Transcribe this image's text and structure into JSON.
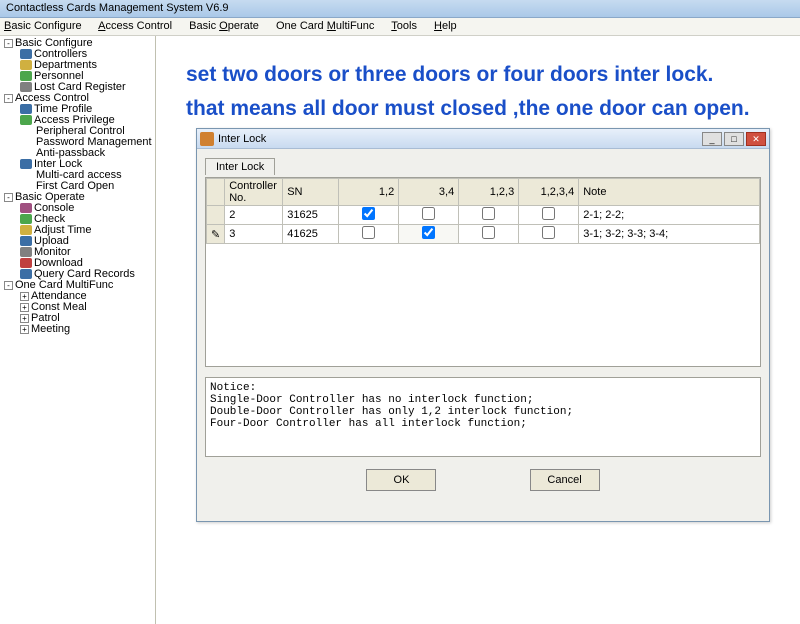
{
  "app": {
    "title": "Contactless Cards Management System  V6.9"
  },
  "menu": {
    "basic_configure": "Basic Configure",
    "access_control": "Access Control",
    "basic_operate": "Basic Operate",
    "one_card": "One Card MultiFunc",
    "tools": "Tools",
    "help": "Help"
  },
  "tree": {
    "basic_configure": "Basic Configure",
    "controllers": "Controllers",
    "departments": "Departments",
    "personnel": "Personnel",
    "lost_card": "Lost Card Register",
    "access_control": "Access Control",
    "time_profile": "Time Profile",
    "access_privilege": "Access Privilege",
    "peripheral": "Peripheral Control",
    "password_mgmt": "Password Management",
    "anti_passback": "Anti-passback",
    "inter_lock": "Inter Lock",
    "multi_card": "Multi-card access",
    "first_card": "First Card Open",
    "basic_operate": "Basic Operate",
    "console": "Console",
    "check": "Check",
    "adjust_time": "Adjust Time",
    "upload": "Upload",
    "monitor": "Monitor",
    "download": "Download",
    "query_records": "Query Card Records",
    "one_card_multi": "One Card MultiFunc",
    "attendance": "Attendance",
    "const_meal": "Const Meal",
    "patrol": "Patrol",
    "meeting": "Meeting"
  },
  "annotation": {
    "line1": "set two doors or three doors or four doors inter lock.",
    "line2": "that means all door must closed ,the one door can open."
  },
  "dialog": {
    "title": "Inter Lock",
    "tab": "Inter Lock",
    "columns": {
      "controller_no": "Controller No.",
      "sn": "SN",
      "c12": "1,2",
      "c34": "3,4",
      "c123": "1,2,3",
      "c1234": "1,2,3,4",
      "note": "Note"
    },
    "rows": [
      {
        "no": "2",
        "sn": "31625",
        "c12": true,
        "c34": false,
        "c123": false,
        "c1234": false,
        "note": "2-1;  2-2;"
      },
      {
        "no": "3",
        "sn": "41625",
        "c12": false,
        "c34": true,
        "c123": false,
        "c1234": false,
        "note": "3-1;  3-2;  3-3;  3-4;"
      }
    ],
    "notice": {
      "heading": "Notice:",
      "l1": "Single-Door Controller has no interlock function;",
      "l2": "Double-Door Controller has only 1,2 interlock function;",
      "l3": "Four-Door Controller has all interlock function;"
    },
    "buttons": {
      "ok": "OK",
      "cancel": "Cancel"
    },
    "win": {
      "min": "_",
      "max": "□",
      "close": "✕"
    }
  }
}
